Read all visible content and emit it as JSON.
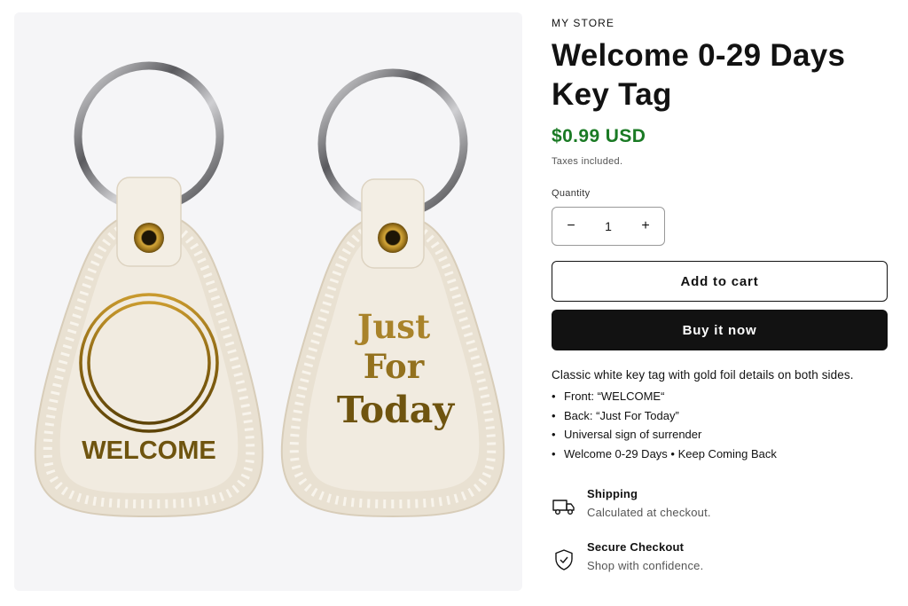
{
  "store": {
    "vendor": "MY STORE"
  },
  "product": {
    "title": "Welcome 0-29 Days Key Tag",
    "price": "$0.99 USD",
    "tax_note": "Taxes included.",
    "quantity_label": "Quantity",
    "quantity_value": "1",
    "decrease_label": "−",
    "increase_label": "+",
    "add_to_cart_label": "Add to cart",
    "buy_now_label": "Buy it now",
    "description": "Classic white key tag with gold foil details on both sides.",
    "bullets": [
      "Front: “WELCOME“",
      "Back: “Just For Today”",
      "Universal sign of surrender",
      "Welcome 0-29 Days • Keep Coming Back"
    ],
    "image": {
      "front_text": "WELCOME",
      "back_line1": "Just",
      "back_line2": "For",
      "back_line3": "Today"
    }
  },
  "features": [
    {
      "title": "Shipping",
      "subtitle": "Calculated at checkout.",
      "icon": "truck-icon"
    },
    {
      "title": "Secure Checkout",
      "subtitle": "Shop with confidence.",
      "icon": "shield-check-icon"
    }
  ],
  "colors": {
    "price": "#1a7a24",
    "button_dark": "#121212",
    "media_bg": "#f5f5f7",
    "tag_body": "#f1ebe0",
    "gold": "#8a6a14"
  }
}
